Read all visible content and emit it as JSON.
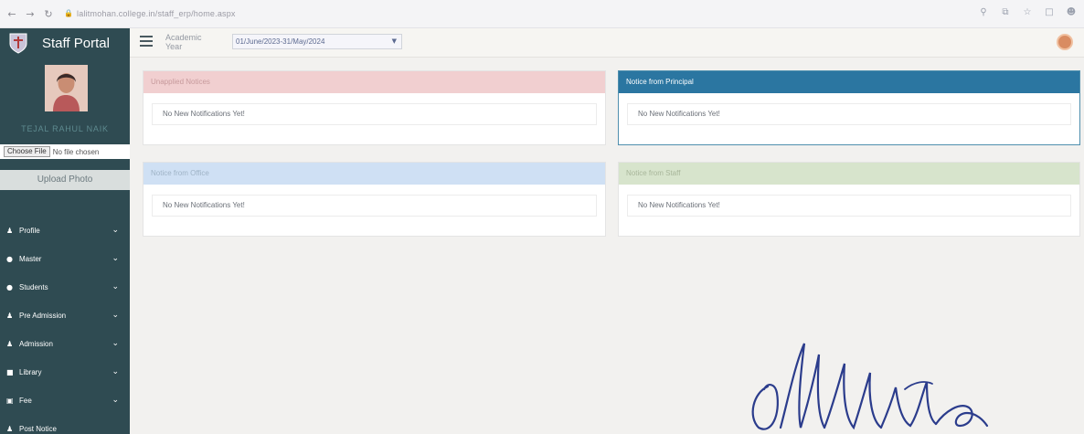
{
  "browser": {
    "url": "lalitmohan.college.in/staff_erp/home.aspx"
  },
  "sidebar": {
    "title": "Staff Portal",
    "profile_name": "TEJAL RAHUL NAIK",
    "choose_file_label": "Choose File",
    "file_status": "No file chosen",
    "upload_label": "Upload Photo",
    "menu": [
      {
        "label": "Profile",
        "icon": "users-icon"
      },
      {
        "label": "Master",
        "icon": "dot-icon"
      },
      {
        "label": "Students",
        "icon": "dot-icon"
      },
      {
        "label": "Pre Admission",
        "icon": "users-icon"
      },
      {
        "label": "Admission",
        "icon": "users-icon"
      },
      {
        "label": "Library",
        "icon": "book-icon"
      },
      {
        "label": "Fee",
        "icon": "fee-icon"
      },
      {
        "label": "Post Notice",
        "icon": "users-icon"
      }
    ]
  },
  "header": {
    "academic_label": "Academic Year",
    "academic_value": "01/June/2023-31/May/2024"
  },
  "panels": {
    "p1": {
      "title": "Unapplied Notices",
      "body": "No New Notifications Yet!"
    },
    "p2": {
      "title": "Notice from Principal",
      "body": "No New Notifications Yet!"
    },
    "p3": {
      "title": "Notice from Office",
      "body": "No New Notifications Yet!"
    },
    "p4": {
      "title": "Notice from Staff",
      "body": "No New Notifications Yet!"
    }
  },
  "colors": {
    "sidebar_bg": "#2f4b52",
    "principal_header": "#2b76a1",
    "unapplied_header": "#f1cfd0",
    "office_header": "#cfe0f4",
    "staff_header": "#d7e4cc",
    "signature_ink": "#2b3c8c"
  }
}
